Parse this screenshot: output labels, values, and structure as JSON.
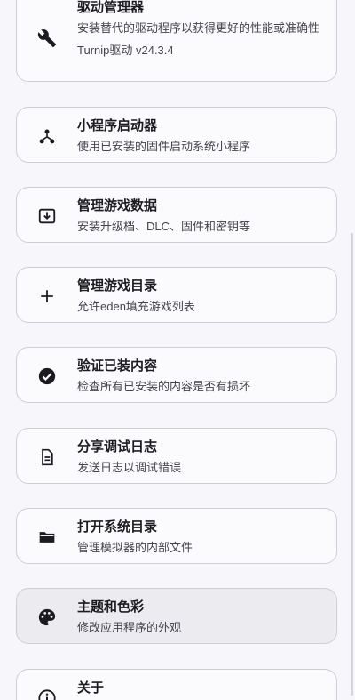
{
  "items": [
    {
      "title": "驱动管理器",
      "subtitle": "安装替代的驱动程序以获得更好的性能或准确性",
      "extra": "Turnip驱动  v24.3.4",
      "icon": "wrench-icon"
    },
    {
      "title": "小程序启动器",
      "subtitle": "使用已安装的固件启动系统小程序",
      "icon": "applet-launcher-icon"
    },
    {
      "title": "管理游戏数据",
      "subtitle": "安装升级档、DLC、固件和密钥等",
      "icon": "download-box-icon"
    },
    {
      "title": "管理游戏目录",
      "subtitle": "允许eden填充游戏列表",
      "icon": "plus-icon"
    },
    {
      "title": "验证已装内容",
      "subtitle": "检查所有已安装的内容是否有损坏",
      "icon": "check-circle-icon"
    },
    {
      "title": "分享调试日志",
      "subtitle": "发送日志以调试错误",
      "icon": "document-icon"
    },
    {
      "title": "打开系统目录",
      "subtitle": "管理模拟器的内部文件",
      "icon": "folder-icon"
    },
    {
      "title": "主题和色彩",
      "subtitle": "修改应用程序的外观",
      "icon": "palette-icon"
    },
    {
      "title": "关于",
      "subtitle": "",
      "icon": "info-icon"
    }
  ]
}
